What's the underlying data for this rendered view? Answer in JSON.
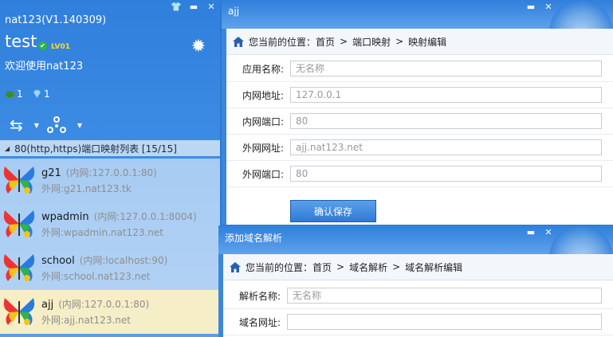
{
  "main": {
    "title": "nat123(V1.140309)",
    "username": "test",
    "level": "LV01",
    "welcome": "欢迎使用nat123",
    "stat_turtle": "1",
    "stat_gem": "1",
    "list_header": "80(http,https)端口映射列表 [15/15]",
    "items": [
      {
        "name": "g21",
        "internal": "(内网:127.0.0.1:80)",
        "external": "外网:g21.nat123.tk"
      },
      {
        "name": "wpadmin",
        "internal": "(内网:127.0.0.1:8004)",
        "external": "外网:wpadmin.nat123.net"
      },
      {
        "name": "school",
        "internal": "(内网:localhost:90)",
        "external": "外网:school.nat123.net"
      },
      {
        "name": "ajj",
        "internal": "(内网:127.0.0.1:80)",
        "external": "外网:ajj.nat123.net"
      }
    ]
  },
  "win1": {
    "title": "ajj",
    "crumb": {
      "prefix": "您当前的位置：",
      "home": "首页",
      "sep": ">",
      "p1": "端口映射",
      "p2": "映射编辑"
    },
    "fields": [
      {
        "label": "应用名称:",
        "value": "无名称"
      },
      {
        "label": "内网地址:",
        "value": "127.0.0.1"
      },
      {
        "label": "内网端口:",
        "value": "80"
      },
      {
        "label": "外网网址:",
        "value": "ajj.nat123.net"
      },
      {
        "label": "外网端口:",
        "value": "80"
      }
    ],
    "save_label": "确认保存"
  },
  "win2": {
    "title": "添加域名解析",
    "crumb": {
      "prefix": "您当前的位置：",
      "home": "首页",
      "sep": ">",
      "p1": "域名解析",
      "p2": "域名解析编辑"
    },
    "fields": [
      {
        "label": "解析名称:",
        "value": "无名称"
      },
      {
        "label": "域名网址:",
        "value": ""
      }
    ]
  },
  "colors": {
    "accent": "#2f7fdc",
    "selected_row": "#f6eec6",
    "level_badge": "#ffd92b"
  }
}
